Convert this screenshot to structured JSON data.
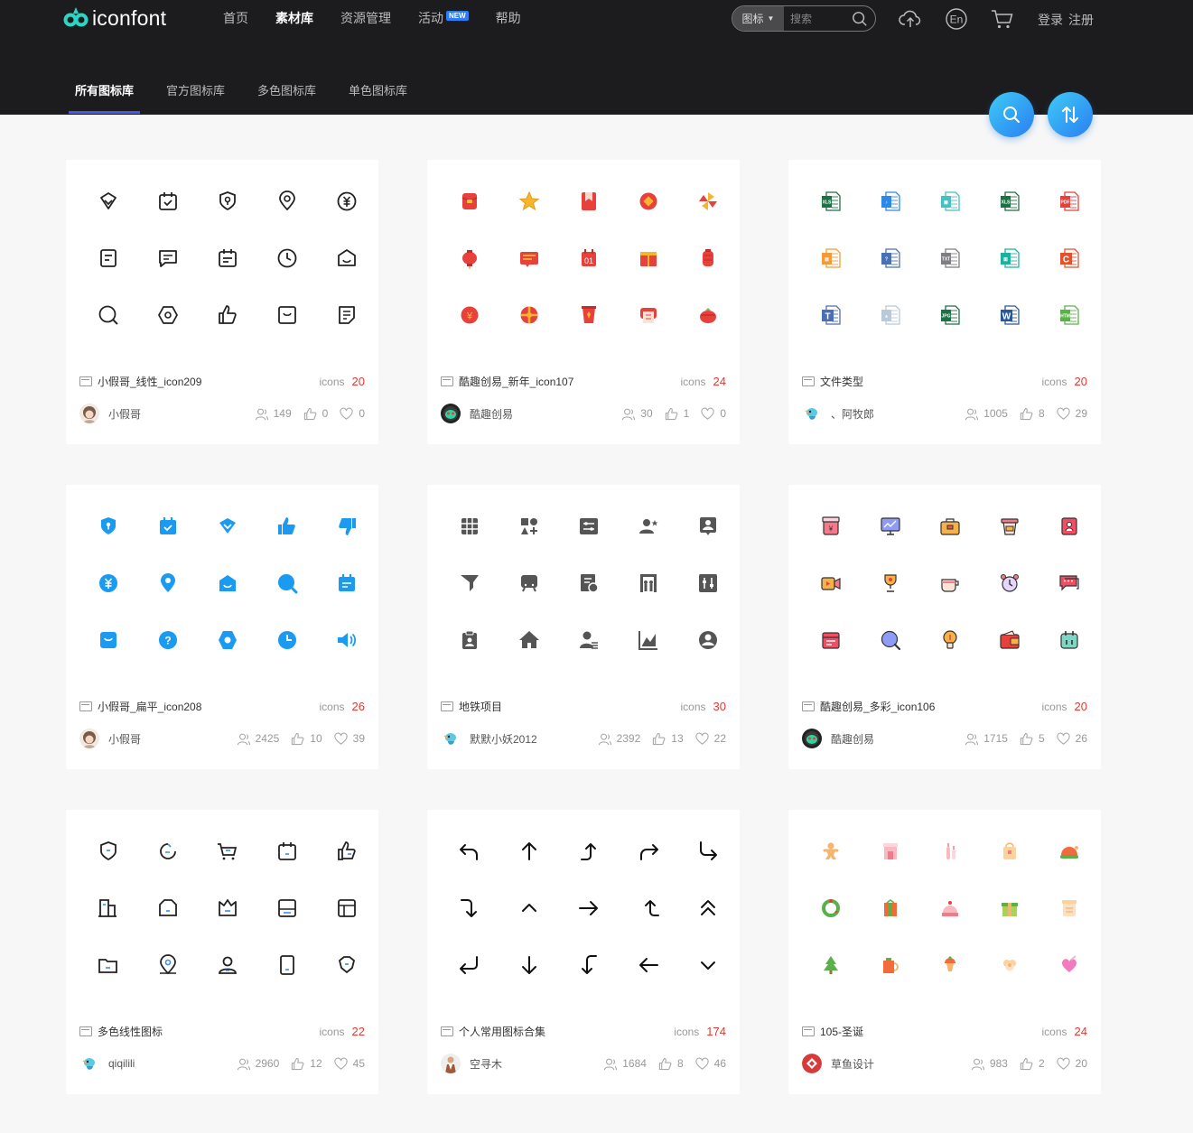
{
  "brand": {
    "name": "iconfont"
  },
  "nav": [
    {
      "label": "首页",
      "active": false,
      "badge": ""
    },
    {
      "label": "素材库",
      "active": true,
      "badge": ""
    },
    {
      "label": "资源管理",
      "active": false,
      "badge": ""
    },
    {
      "label": "活动",
      "active": false,
      "badge": "NEW"
    },
    {
      "label": "帮助",
      "active": false,
      "badge": ""
    }
  ],
  "search": {
    "type": "图标",
    "placeholder": "搜索"
  },
  "auth": {
    "login": "登录",
    "register": "注册"
  },
  "subnav": [
    {
      "label": "所有图标库",
      "active": true
    },
    {
      "label": "官方图标库",
      "active": false
    },
    {
      "label": "多色图标库",
      "active": false
    },
    {
      "label": "单色图标库",
      "active": false
    }
  ],
  "cards": [
    {
      "title": "小假哥_线性_icon209",
      "icons_label": "icons",
      "count": "20",
      "author": "小假哥",
      "views": "149",
      "likes": "0",
      "favs": "0",
      "style": "line",
      "avatar": "girl"
    },
    {
      "title": "酷趣创易_新年_icon107",
      "icons_label": "icons",
      "count": "24",
      "author": "酷趣创易",
      "views": "30",
      "likes": "1",
      "favs": "0",
      "style": "newyear",
      "avatar": "mask"
    },
    {
      "title": "文件类型",
      "icons_label": "icons",
      "count": "20",
      "author": "、阿牧郎",
      "views": "1005",
      "likes": "8",
      "favs": "29",
      "style": "files",
      "avatar": "bird"
    },
    {
      "title": "小假哥_扁平_icon208",
      "icons_label": "icons",
      "count": "26",
      "author": "小假哥",
      "views": "2425",
      "likes": "10",
      "favs": "39",
      "style": "blue",
      "avatar": "girl"
    },
    {
      "title": "地铁项目",
      "icons_label": "icons",
      "count": "30",
      "author": "默默小妖2012",
      "views": "2392",
      "likes": "13",
      "favs": "22",
      "style": "gray",
      "avatar": "bird"
    },
    {
      "title": "酷趣创易_多彩_icon106",
      "icons_label": "icons",
      "count": "20",
      "author": "酷趣创易",
      "views": "1715",
      "likes": "5",
      "favs": "26",
      "style": "colorful",
      "avatar": "mask"
    },
    {
      "title": "多色线性图标",
      "icons_label": "icons",
      "count": "22",
      "author": "qiqilili",
      "views": "2960",
      "likes": "12",
      "favs": "45",
      "style": "line2",
      "avatar": "bird"
    },
    {
      "title": "个人常用图标合集",
      "icons_label": "icons",
      "count": "174",
      "author": "空寻木",
      "views": "1684",
      "likes": "8",
      "favs": "46",
      "style": "arrows",
      "avatar": "person"
    },
    {
      "title": "105-圣诞",
      "icons_label": "icons",
      "count": "24",
      "author": "草鱼设计",
      "views": "983",
      "likes": "2",
      "favs": "20",
      "style": "xmas",
      "avatar": "red"
    }
  ],
  "colors": {
    "header_bg": "#1c1c1e",
    "accent": "#4856ef",
    "count_red": "#e53935",
    "fab": "#2a7ef2"
  }
}
